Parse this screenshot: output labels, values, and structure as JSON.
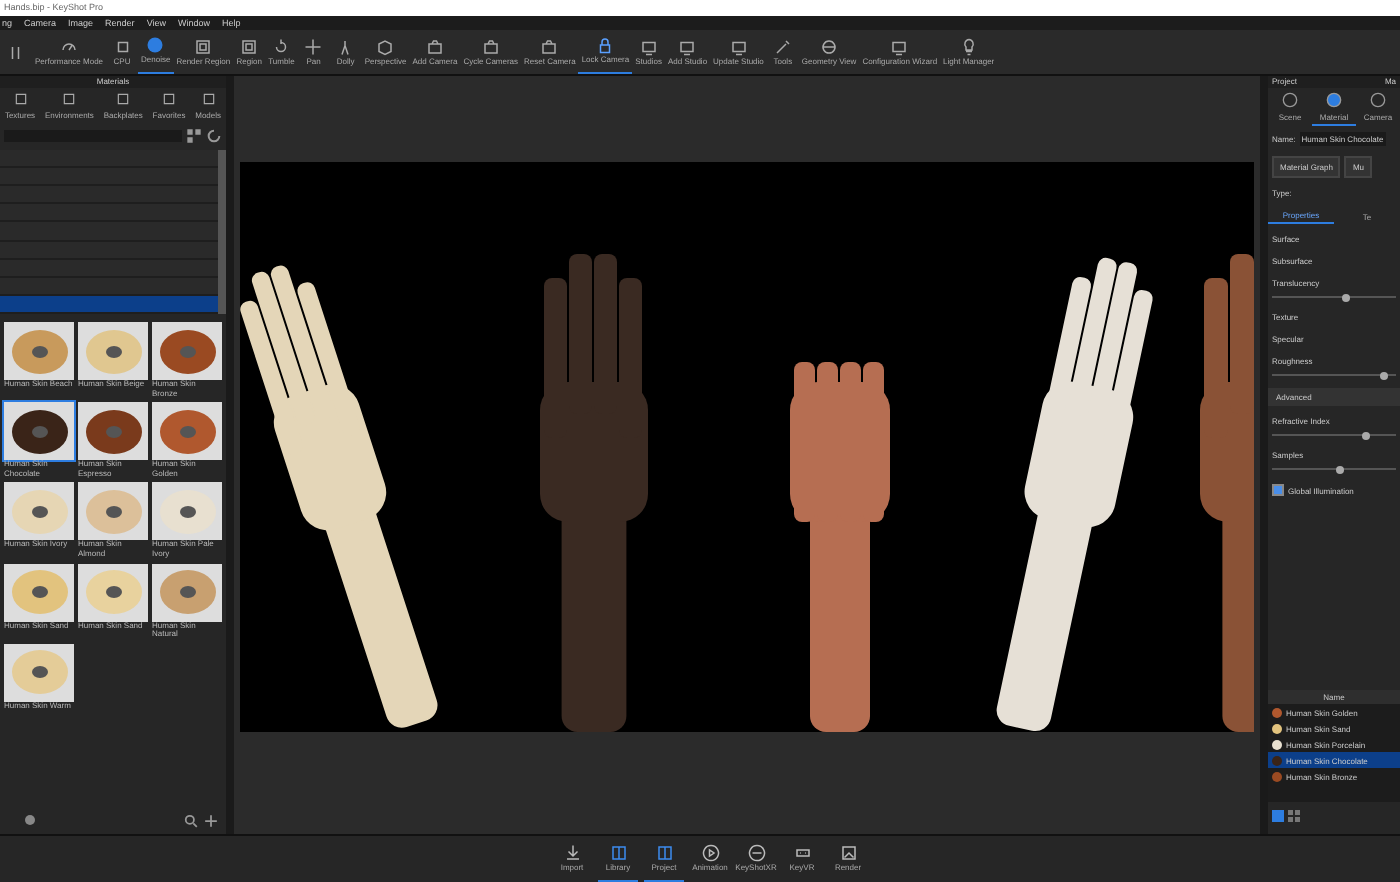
{
  "window": {
    "title": "Hands.bip - KeyShot Pro"
  },
  "menu": [
    "ng",
    "Camera",
    "Image",
    "Render",
    "View",
    "Window",
    "Help"
  ],
  "toolbar": [
    {
      "selected": false
    },
    {
      "label": "Performance Mode",
      "selected": false
    },
    {
      "label": "CPU",
      "selected": false
    },
    {
      "label": "Denoise",
      "selected": true
    },
    {
      "label": "Render Region",
      "selected": false
    },
    {
      "label": "Region",
      "selected": false
    },
    {
      "label": "Tumble",
      "selected": false
    },
    {
      "label": "Pan",
      "selected": false
    },
    {
      "label": "Dolly",
      "selected": false
    },
    {
      "label": "Perspective",
      "selected": false
    },
    {
      "label": "Add Camera",
      "selected": false
    },
    {
      "label": "Cycle Cameras",
      "selected": false
    },
    {
      "label": "Reset Camera",
      "selected": false
    },
    {
      "label": "Lock Camera",
      "selected": true
    },
    {
      "label": "Studios",
      "selected": false
    },
    {
      "label": "Add Studio",
      "selected": false
    },
    {
      "label": "Update Studio",
      "selected": false
    },
    {
      "label": "Tools",
      "selected": false
    },
    {
      "label": "Geometry View",
      "selected": false
    },
    {
      "label": "Configuration Wizard",
      "selected": false
    },
    {
      "label": "Light Manager",
      "selected": false
    }
  ],
  "library": {
    "title": "Materials",
    "tabs": [
      {
        "label": "Textures",
        "selected": false
      },
      {
        "label": "Environments",
        "selected": false
      },
      {
        "label": "Backplates",
        "selected": false
      },
      {
        "label": "Favorites",
        "selected": false
      },
      {
        "label": "Models",
        "selected": false
      }
    ],
    "folder_rows": [
      {
        "selected": false
      },
      {
        "selected": false
      },
      {
        "selected": false
      },
      {
        "selected": false
      },
      {
        "selected": false
      },
      {
        "selected": false
      },
      {
        "selected": false
      },
      {
        "selected": false
      },
      {
        "selected": true
      }
    ],
    "thumbnails": [
      {
        "label": "Human Skin Beach",
        "color": "#c89a5c",
        "selected": false
      },
      {
        "label": "Human Skin Beige",
        "color": "#e0c790",
        "selected": false
      },
      {
        "label": "Human Skin Bronze",
        "color": "#9a4a22",
        "selected": false
      },
      {
        "label": "Human Skin Chocolate",
        "color": "#3a2418",
        "selected": true
      },
      {
        "label": "Human Skin Espresso",
        "color": "#7a3a1c",
        "selected": false
      },
      {
        "label": "Human Skin Golden",
        "color": "#b0582e",
        "selected": false
      },
      {
        "label": "Human Skin Ivory",
        "color": "#e6d6b4",
        "selected": false
      },
      {
        "label": "Human Skin Almond",
        "color": "#dcc09a",
        "selected": false
      },
      {
        "label": "Human Skin Pale Ivory",
        "color": "#e8e0d0",
        "selected": false
      },
      {
        "label": "Human Skin Sand",
        "color": "#e2c37e",
        "selected": false
      },
      {
        "label": "Human Skin Sand",
        "color": "#e8d29e",
        "selected": false
      },
      {
        "label": "Human Skin Natural",
        "color": "#c8a070",
        "selected": false
      },
      {
        "label": "Human Skin Warm",
        "color": "#e4cc98",
        "selected": false
      }
    ]
  },
  "bottom_toolbar": [
    {
      "label": "Import",
      "selected": false
    },
    {
      "label": "Library",
      "selected": true
    },
    {
      "label": "Project",
      "selected": true
    },
    {
      "label": "Animation",
      "selected": false
    },
    {
      "label": "KeyShotXR",
      "selected": false
    },
    {
      "label": "KeyVR",
      "selected": false
    },
    {
      "label": "Render",
      "selected": false
    }
  ],
  "project": {
    "title": "Project",
    "title_2": "Ma",
    "tabs": [
      {
        "label": "Scene",
        "selected": false
      },
      {
        "label": "Material",
        "selected": true
      },
      {
        "label": "Camera",
        "selected": false
      }
    ],
    "name_label": "Name:",
    "name_value": "Human Skin Chocolate",
    "buttons": [
      "Material Graph",
      "Mu"
    ],
    "type_label": "Type:",
    "subtabs": [
      {
        "label": "Properties",
        "selected": true
      },
      {
        "label": "Te",
        "selected": false
      }
    ],
    "properties": [
      {
        "label": "Surface",
        "kind": "label"
      },
      {
        "label": "Subsurface",
        "kind": "label"
      },
      {
        "label": "Translucency",
        "kind": "slider",
        "level": 0.6
      },
      {
        "label": "Texture",
        "kind": "label"
      },
      {
        "label": "Specular",
        "kind": "label"
      },
      {
        "label": "Roughness",
        "kind": "slider",
        "level": 0.9
      },
      {
        "label": "Advanced",
        "kind": "section"
      },
      {
        "label": "Refractive Index",
        "kind": "slider",
        "level": 0.75
      },
      {
        "label": "Samples",
        "kind": "slider",
        "level": 0.55
      },
      {
        "label": "Global Illumination",
        "kind": "checkbox",
        "checked": true
      }
    ],
    "list_header": "Name",
    "materials": [
      {
        "label": "Human Skin Golden",
        "color": "#b0582e",
        "selected": false
      },
      {
        "label": "Human Skin Sand",
        "color": "#e2c37e",
        "selected": false
      },
      {
        "label": "Human Skin Porcelain",
        "color": "#e8e0d0",
        "selected": false
      },
      {
        "label": "Human Skin Chocolate",
        "color": "#3a2418",
        "selected": true
      },
      {
        "label": "Human Skin Bronze",
        "color": "#9a4a22",
        "selected": false
      }
    ]
  }
}
